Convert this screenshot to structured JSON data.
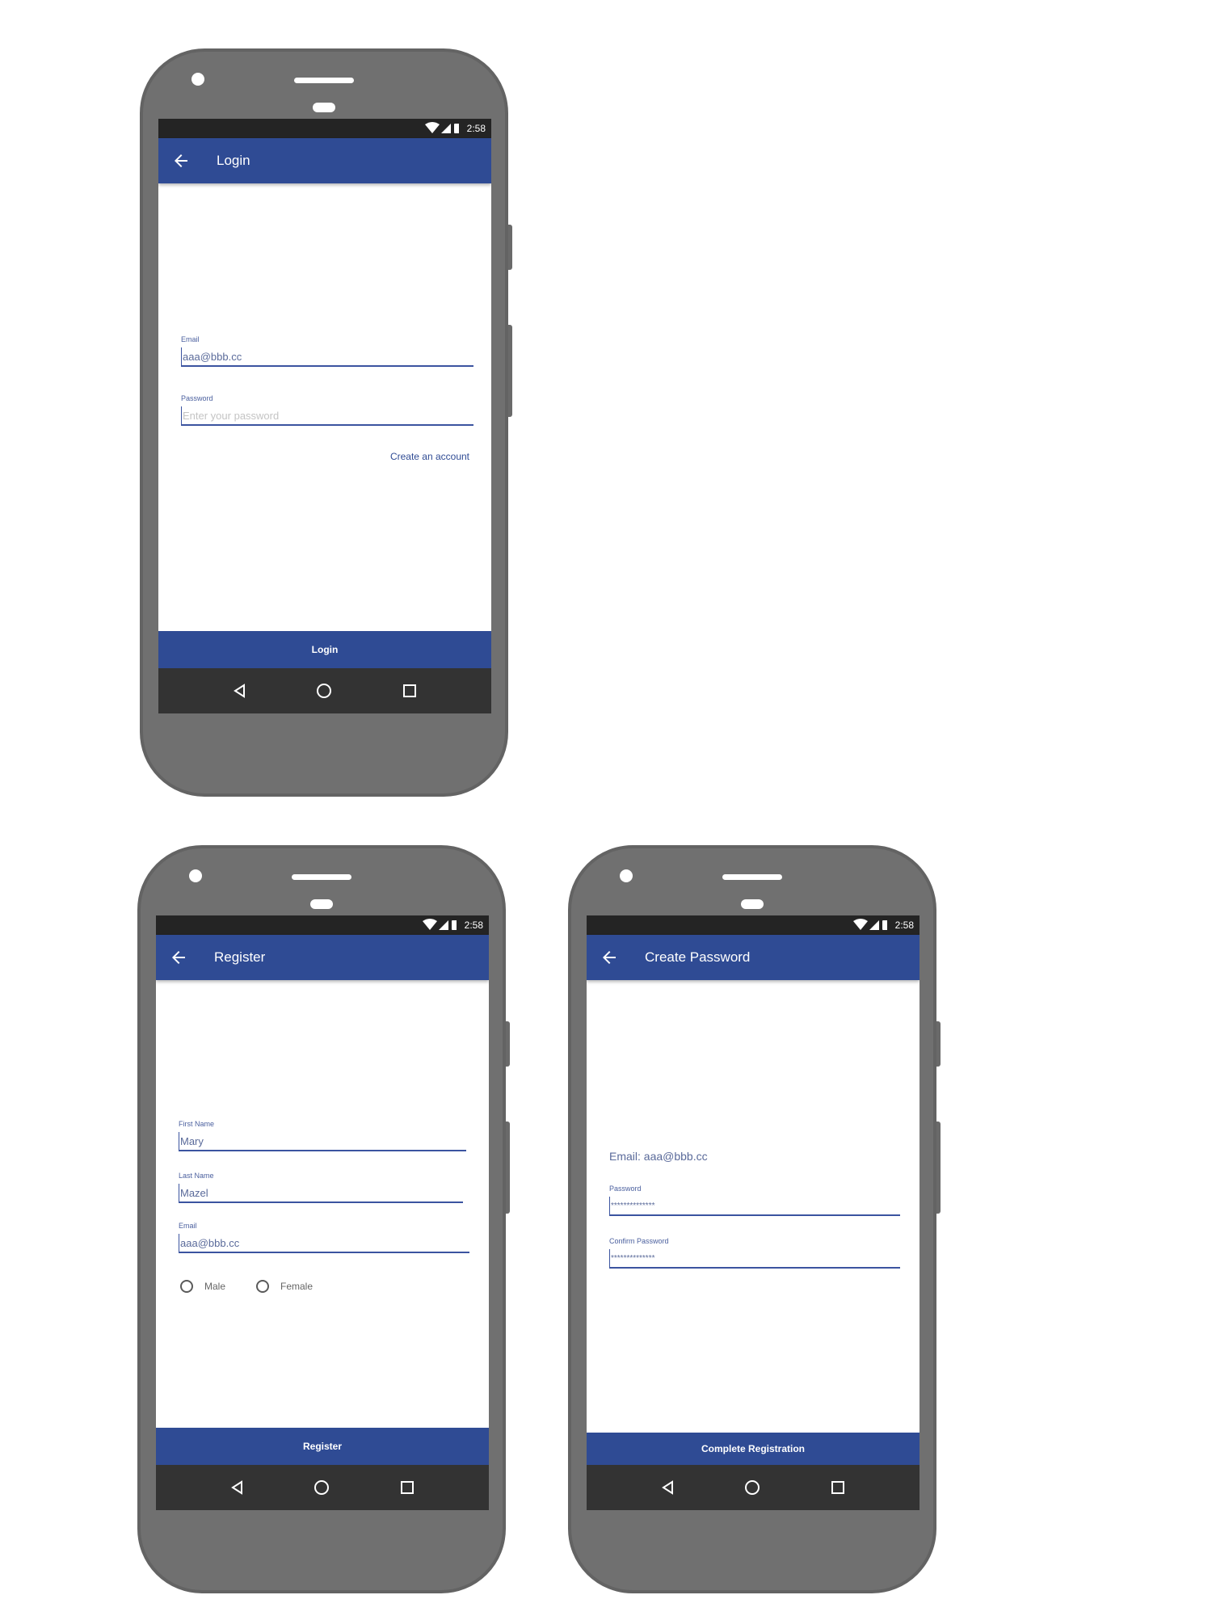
{
  "status": {
    "time": "2:58"
  },
  "login": {
    "title": "Login",
    "email_label": "Email",
    "email_value": "aaa@bbb.cc",
    "password_label": "Password",
    "password_placeholder": "Enter your password",
    "create_account": "Create an account",
    "button": "Login"
  },
  "register": {
    "title": "Register",
    "first_name_label": "First Name",
    "first_name_value": "Mary",
    "last_name_label": "Last Name",
    "last_name_value": "Mazel",
    "email_label": "Email",
    "email_value": "aaa@bbb.cc",
    "gender_options": [
      "Male",
      "Female"
    ],
    "button": "Register"
  },
  "create_password": {
    "title": "Create Password",
    "email_text": "Email: aaa@bbb.cc",
    "password_label": "Password",
    "password_value": "**************",
    "confirm_label": "Confirm Password",
    "confirm_value": "**************",
    "button": "Complete Registration"
  },
  "colors": {
    "primary": "#2f4b94",
    "statusbar": "#242424",
    "navbar": "#333333",
    "phone_body": "#707070"
  },
  "icons": [
    "back-arrow-icon",
    "wifi-icon",
    "signal-icon",
    "battery-icon",
    "nav-back-icon",
    "nav-home-icon",
    "nav-recents-icon"
  ]
}
